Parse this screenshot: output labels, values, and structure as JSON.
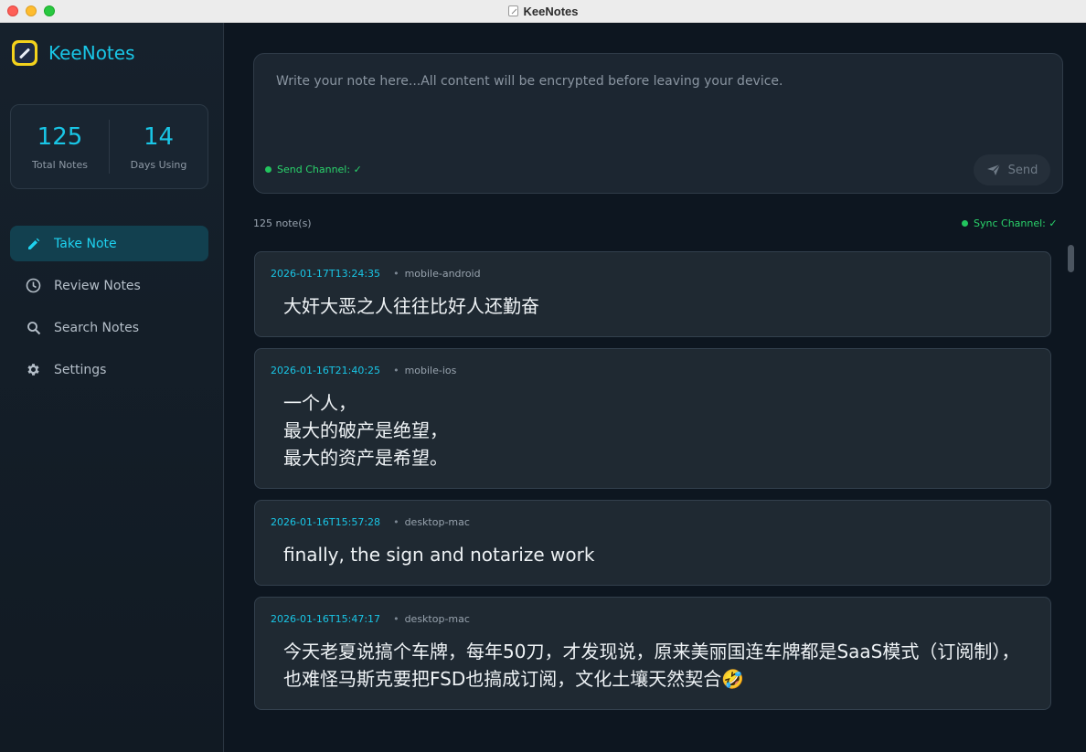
{
  "window": {
    "title": "KeeNotes"
  },
  "sidebar": {
    "brand": "KeeNotes",
    "stats": [
      {
        "value": "125",
        "label": "Total Notes"
      },
      {
        "value": "14",
        "label": "Days Using"
      }
    ],
    "nav": [
      {
        "label": "Take Note",
        "icon": "pencil-icon",
        "active": true
      },
      {
        "label": "Review Notes",
        "icon": "clock-icon",
        "active": false
      },
      {
        "label": "Search Notes",
        "icon": "search-icon",
        "active": false
      },
      {
        "label": "Settings",
        "icon": "gear-icon",
        "active": false
      }
    ]
  },
  "composer": {
    "placeholder": "Write your note here...All content will be encrypted before leaving your device.",
    "send_channel": "Send Channel: ✓",
    "send_label": "Send"
  },
  "notes_header": {
    "count": "125 note(s)",
    "sync_channel": "Sync Channel: ✓"
  },
  "notes": [
    {
      "time": "2026-01-17T13:24:35",
      "device": "mobile-android",
      "content": "大奸大恶之人往往比好人还勤奋"
    },
    {
      "time": "2026-01-16T21:40:25",
      "device": "mobile-ios",
      "content": "一个人，\n最大的破产是绝望，\n最大的资产是希望。"
    },
    {
      "time": "2026-01-16T15:57:28",
      "device": "desktop-mac",
      "content": "finally, the sign and notarize work"
    },
    {
      "time": "2026-01-16T15:47:17",
      "device": "desktop-mac",
      "content": "今天老夏说搞个车牌，每年50刀，才发现说，原来美丽国连车牌都是SaaS模式（订阅制），也难怪马斯克要把FSD也搞成订阅，文化土壤天然契合🤣"
    }
  ],
  "colors": {
    "accent": "#19c6e6",
    "status_green": "#22c55e",
    "active_nav_bg": "#12404f"
  }
}
